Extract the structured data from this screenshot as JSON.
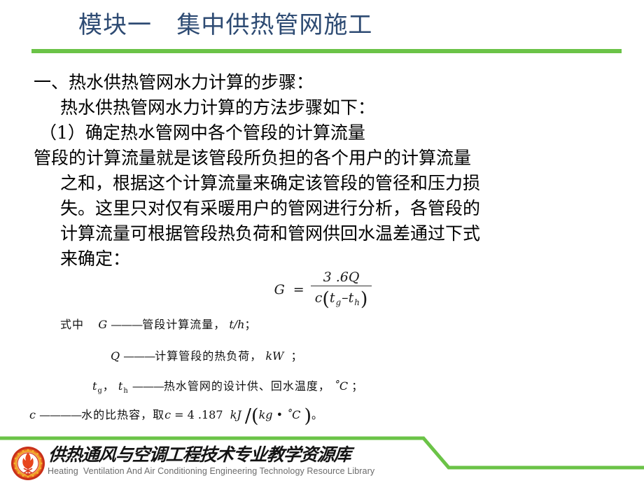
{
  "slide": {
    "title": "模块一   集中供热管网施工",
    "title_color": "#2E4B73",
    "accent_color": "#6BC347",
    "background_color": "#FFFFFF"
  },
  "body": {
    "lines": [
      {
        "text": "一、热水供热管网水力计算的步骤：",
        "indent": "indent-0"
      },
      {
        "text": "热水供热管网水力计算的方法步骤如下：",
        "indent": "indent-1"
      },
      {
        "text": "（1）确定热水管网中各个管段的计算流量",
        "indent": "indent-half"
      },
      {
        "text": "管段的计算流量就是该管段所负担的各个用户的计算流量",
        "indent": "indent-0"
      },
      {
        "text": "之和，根据这个计算流量来确定该管段的管径和压力损",
        "indent": "indent-1"
      },
      {
        "text": "失。这里只对仅有采暖用户的管网进行分析，各管段的",
        "indent": "indent-1"
      },
      {
        "text": "计算流量可根据管段热负荷和管网供回水温差通过下式",
        "indent": "indent-1"
      },
      {
        "text": "来确定：",
        "indent": "indent-1"
      }
    ]
  },
  "formula": {
    "lhs": "G",
    "equals": "=",
    "numerator": "3 .6Q",
    "numerator_coefficient": "3.6",
    "numerator_symbol": "Q",
    "denominator_display": "c ( t g – t h )",
    "denominator_symbol": "c",
    "denominator_paren_open": "(",
    "denominator_t1": "t",
    "denominator_t1_sub": "g",
    "denominator_minus": "–",
    "denominator_t2": "t",
    "denominator_t2_sub": "h",
    "denominator_paren_close": ")"
  },
  "nomenclature": {
    "label": "式中",
    "items": [
      {
        "symbol": "G",
        "dash": "———",
        "description": "管段计算流量，",
        "unit": "t/h",
        "terminator": "；"
      },
      {
        "symbol": "Q",
        "dash": "———",
        "description": "计算管段的热负荷，",
        "unit": "kW",
        "terminator": "；"
      },
      {
        "symbol": "t",
        "symbol_sub": "g",
        "symbol2": "t",
        "symbol2_sub": "h",
        "separator": "，",
        "dash": "———",
        "description": "热水管网的设计供、回水温度，",
        "unit": "˚C",
        "terminator": "；"
      },
      {
        "symbol": "c",
        "dash": "————",
        "description": "水的比热容，取",
        "value_symbol": "c",
        "value_equals": "=",
        "value": "4 .187",
        "unit": "kJ",
        "unit_divider": "/",
        "unit_paren_open": "(",
        "unit_denominator_1": "kg",
        "unit_dot": "•",
        "unit_denominator_2": "˚C",
        "unit_paren_close": ")",
        "terminator": "。"
      }
    ]
  },
  "footer": {
    "brand_cn": "供热通风与空调工程技术专业教学资源库",
    "brand_en": "Heating  Ventilation And Air Conditioning Engineering Technology Resource Library",
    "logo_name": "flame-snowflake-emblem",
    "logo_colors": {
      "ring": "#D93A1E",
      "flame": "#E8451C",
      "accent": "#F5A623"
    },
    "rule_color": "#6BC347"
  }
}
